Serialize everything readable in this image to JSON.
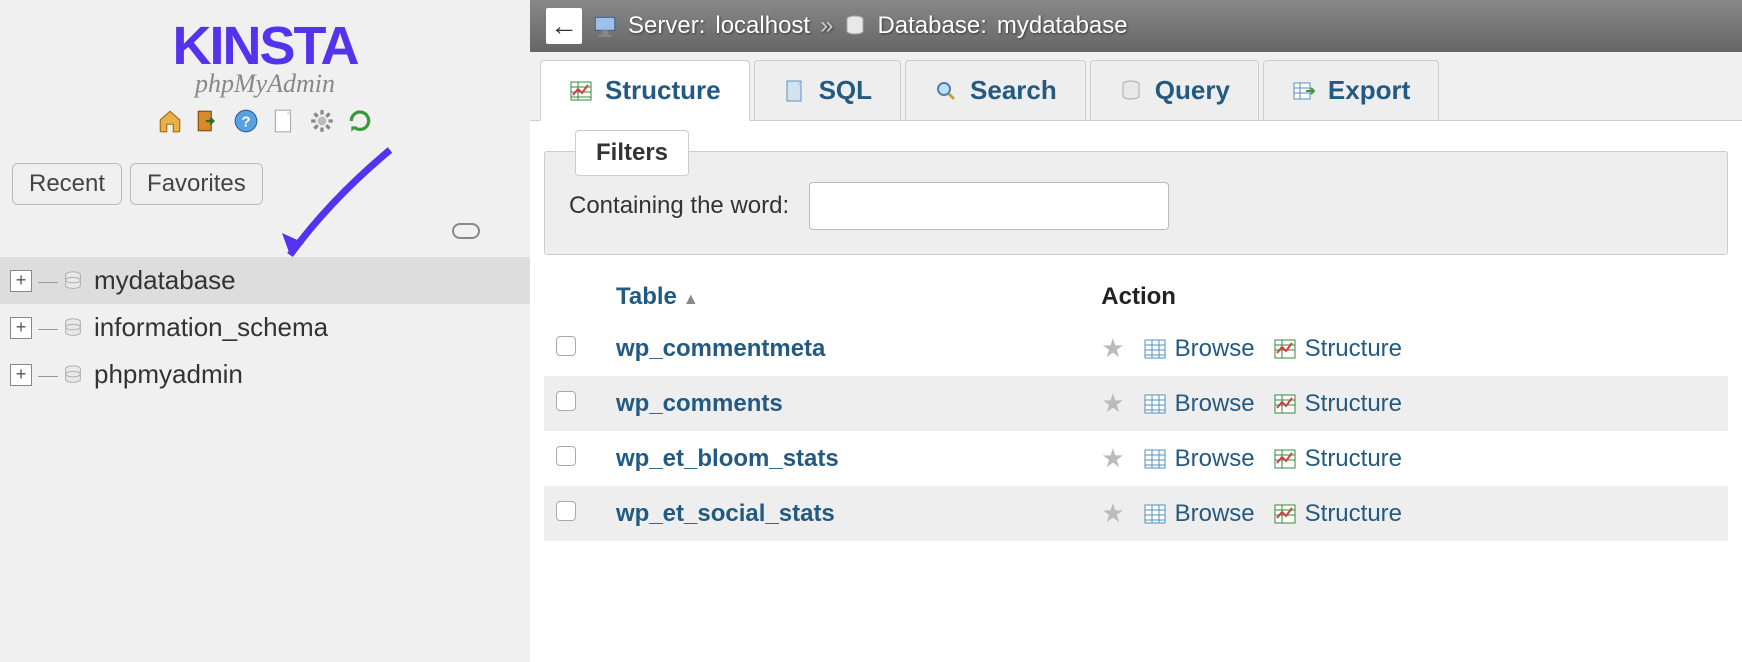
{
  "logo": {
    "brand": "KINSTA",
    "sub": "phpMyAdmin"
  },
  "sidebar": {
    "tabs": {
      "recent": "Recent",
      "favorites": "Favorites"
    },
    "databases": [
      {
        "name": "mydatabase",
        "selected": true
      },
      {
        "name": "information_schema",
        "selected": false
      },
      {
        "name": "phpmyadmin",
        "selected": false
      }
    ]
  },
  "breadcrumb": {
    "server_label": "Server:",
    "server_value": "localhost",
    "sep": "»",
    "db_label": "Database:",
    "db_value": "mydatabase"
  },
  "main_tabs": [
    {
      "id": "structure",
      "label": "Structure",
      "active": true
    },
    {
      "id": "sql",
      "label": "SQL"
    },
    {
      "id": "search",
      "label": "Search"
    },
    {
      "id": "query",
      "label": "Query"
    },
    {
      "id": "export",
      "label": "Export"
    }
  ],
  "filters": {
    "legend": "Filters",
    "label": "Containing the word:",
    "value": ""
  },
  "table_header": {
    "table": "Table",
    "action": "Action"
  },
  "tables": [
    {
      "name": "wp_commentmeta"
    },
    {
      "name": "wp_comments"
    },
    {
      "name": "wp_et_bloom_stats"
    },
    {
      "name": "wp_et_social_stats"
    }
  ],
  "actions": {
    "browse": "Browse",
    "structure": "Structure"
  }
}
